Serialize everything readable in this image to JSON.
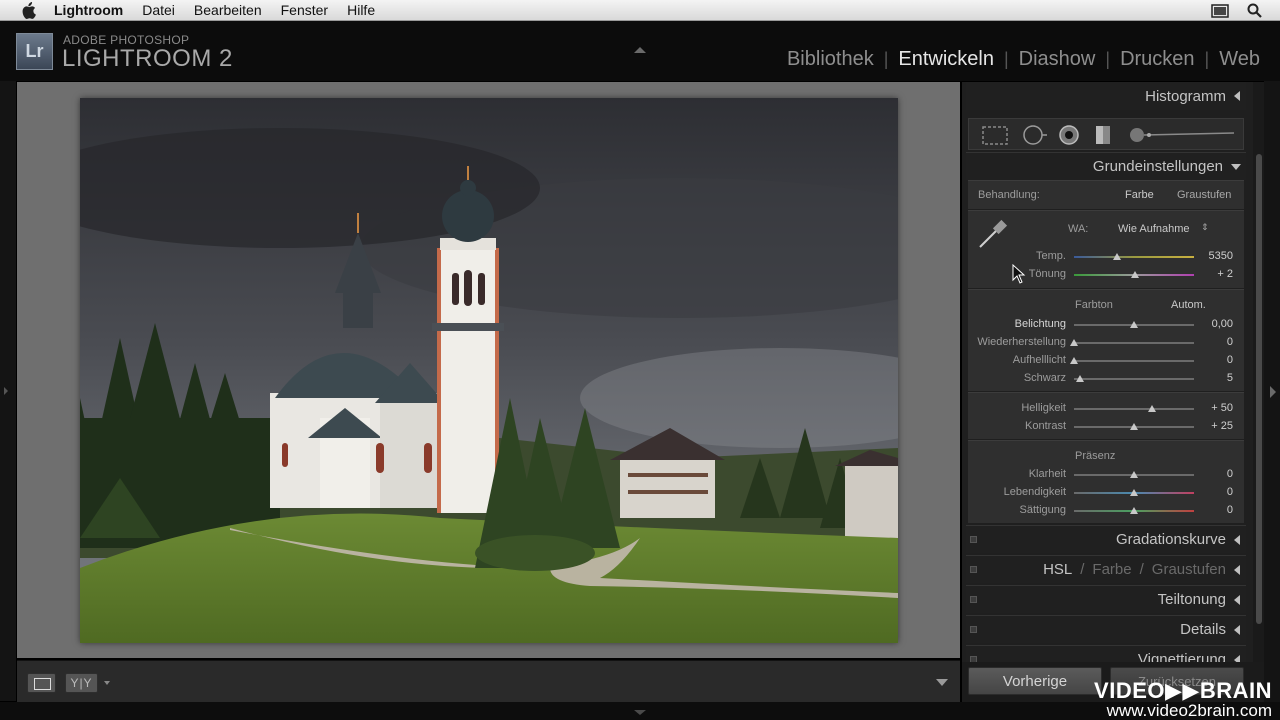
{
  "menubar": {
    "app": "Lightroom",
    "items": [
      "Datei",
      "Bearbeiten",
      "Fenster",
      "Hilfe"
    ]
  },
  "header": {
    "logo": "Lr",
    "brand_top": "ADOBE PHOTOSHOP",
    "brand_main": "LIGHTROOM 2",
    "modules": [
      {
        "label": "Bibliothek",
        "active": false
      },
      {
        "label": "Entwickeln",
        "active": true
      },
      {
        "label": "Diashow",
        "active": false
      },
      {
        "label": "Drucken",
        "active": false
      },
      {
        "label": "Web",
        "active": false
      }
    ],
    "separator": "|"
  },
  "panel": {
    "histogram": "Histogramm",
    "basic": {
      "title": "Grundeinstellungen",
      "treatment_label": "Behandlung:",
      "treatment_color": "Farbe",
      "treatment_gray": "Graustufen",
      "wb_label": "WA:",
      "wb_value": "Wie Aufnahme",
      "temp": {
        "label": "Temp.",
        "value": "5350",
        "pos": 0.36
      },
      "tint": {
        "label": "Tönung",
        "value": "+ 2",
        "pos": 0.51
      },
      "tone_label": "Farbton",
      "auto": "Autom.",
      "exposure": {
        "label": "Belichtung",
        "value": "0,00",
        "pos": 0.5
      },
      "recovery": {
        "label": "Wiederherstellung",
        "value": "0",
        "pos": 0.0
      },
      "fill": {
        "label": "Aufhelllicht",
        "value": "0",
        "pos": 0.0
      },
      "blacks": {
        "label": "Schwarz",
        "value": "5",
        "pos": 0.05
      },
      "brightness": {
        "label": "Helligkeit",
        "value": "+ 50",
        "pos": 0.65
      },
      "contrast": {
        "label": "Kontrast",
        "value": "+ 25",
        "pos": 0.5
      },
      "presence_label": "Präsenz",
      "clarity": {
        "label": "Klarheit",
        "value": "0",
        "pos": 0.5
      },
      "vibrance": {
        "label": "Lebendigkeit",
        "value": "0",
        "pos": 0.5
      },
      "saturation": {
        "label": "Sättigung",
        "value": "0",
        "pos": 0.5
      }
    },
    "tone_curve": "Gradationskurve",
    "hsl": {
      "hsl": "HSL",
      "color": "Farbe",
      "gray": "Graustufen",
      "sep": "/"
    },
    "split_toning": "Teiltonung",
    "details": "Details",
    "vignette": "Vignettierung"
  },
  "buttons": {
    "previous": "Vorherige",
    "reset": "Zurücksetzen"
  },
  "toolbar": {
    "compare": "Y|Y"
  },
  "watermark": {
    "line1": "VIDEO▶▶BRAIN",
    "line2": "www.video2brain.com"
  },
  "colors": {
    "panel_bg": "#1f1f1f",
    "group_bg": "#2f2f2f",
    "main_bg": "#6f6f6f",
    "active_module": "#e6e6e6"
  }
}
